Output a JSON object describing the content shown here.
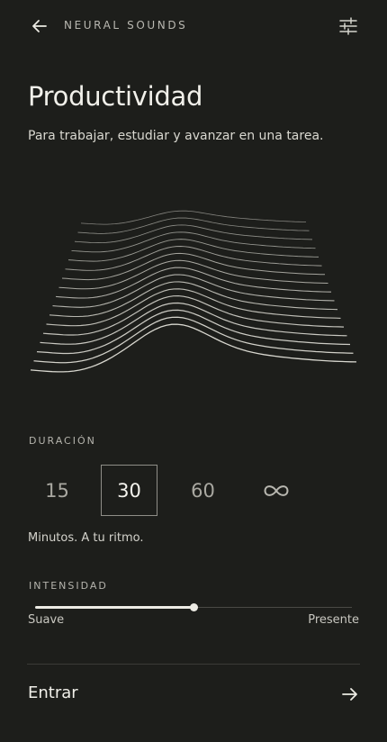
{
  "header": {
    "back_icon": "arrow-left-icon",
    "title": "NEURAL SOUNDS",
    "settings_icon": "sliders-icon"
  },
  "page": {
    "title": "Productividad",
    "subtitle": "Para trabajar, estudiar y avanzar en una tarea."
  },
  "duration": {
    "label": "DURACIÓN",
    "options": [
      "15",
      "30",
      "60",
      "∞"
    ],
    "selected": "30",
    "caption": "Minutos. A tu ritmo."
  },
  "intensity": {
    "label": "INTENSIDAD",
    "value_fraction": 0.5,
    "min_label": "Suave",
    "max_label": "Presente"
  },
  "action": {
    "label": "Entrar",
    "icon": "arrow-right-icon"
  },
  "colors": {
    "background": "#1d1e1b",
    "foreground": "#ecebe4"
  }
}
